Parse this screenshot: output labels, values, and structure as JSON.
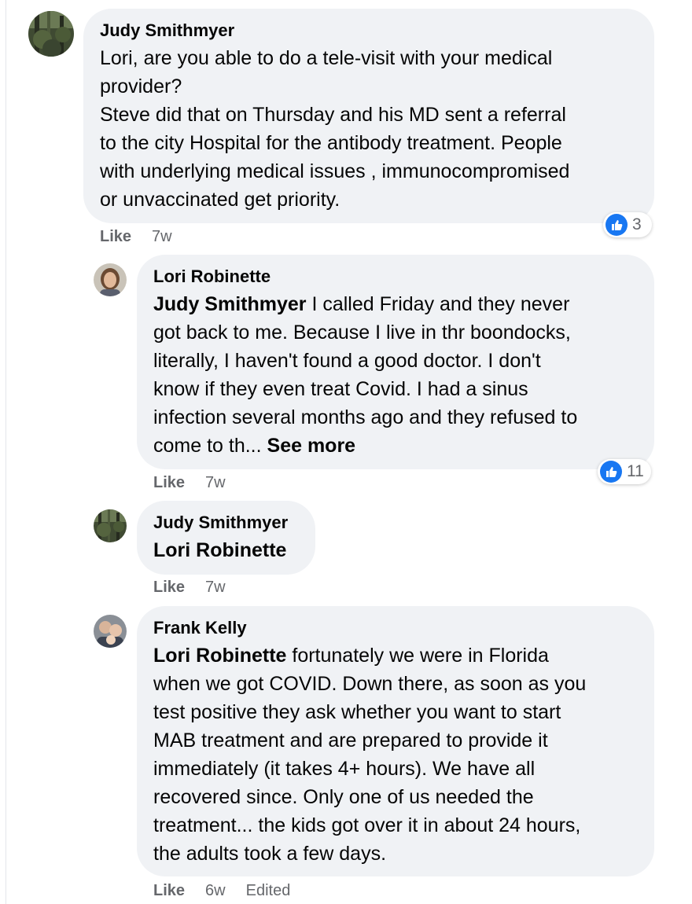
{
  "comments": [
    {
      "author": "Judy Smithmyer",
      "lines": [
        "Lori, are you able to do a tele-visit with your medical",
        "provider?",
        "Steve did that on Thursday and his MD sent a referral",
        "to the city Hospital for the antibody treatment. People",
        "with underlying medical issues , immunocompromised",
        "or unvaccinated get priority."
      ],
      "like_label": "Like",
      "time": "7w",
      "reaction_count": "3"
    },
    {
      "author": "Lori Robinette",
      "mention": "Judy Smithmyer",
      "first_line_rest": " I called Friday and they never",
      "lines": [
        "got back to me. Because I live in thr boondocks,",
        "literally, I haven't found a good doctor. I don't",
        "know if they even treat Covid. I had a sinus",
        "infection several months ago and they refused to"
      ],
      "last_line": "come to th... ",
      "see_more": "See more",
      "like_label": "Like",
      "time": "7w",
      "reaction_count": "11"
    },
    {
      "author": "Judy Smithmyer",
      "mention": "Lori Robinette",
      "like_label": "Like",
      "time": "7w"
    },
    {
      "author": "Frank Kelly",
      "mention": "Lori Robinette",
      "first_line_rest": " fortunately we were in Florida",
      "lines": [
        "when we got COVID. Down there, as soon as you",
        "test positive they ask whether you want to start",
        "MAB treatment and are prepared to provide it",
        "immediately (it takes 4+ hours). We have all",
        "recovered since. Only one of us needed the",
        "treatment... the kids got over it in about 24 hours,",
        "the adults took a few days."
      ],
      "like_label": "Like",
      "time": "6w",
      "edited": "Edited"
    }
  ]
}
